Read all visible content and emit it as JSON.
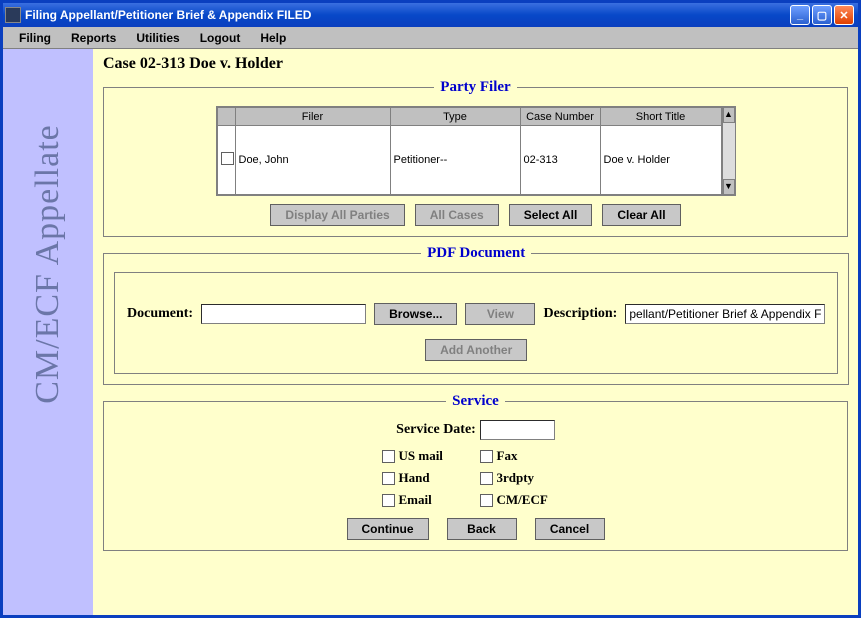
{
  "window": {
    "title": "Filing Appellant/Petitioner Brief & Appendix FILED"
  },
  "menu": {
    "items": [
      "Filing",
      "Reports",
      "Utilities",
      "Logout",
      "Help"
    ]
  },
  "sidebar": {
    "brand": "CM/ECF Appellate"
  },
  "case": {
    "title": "Case 02-313 Doe v. Holder"
  },
  "party_filer": {
    "legend": "Party Filer",
    "columns": [
      "",
      "Filer",
      "Type",
      "Case Number",
      "Short Title"
    ],
    "rows": [
      {
        "checked": false,
        "filer": "Doe, John",
        "type": "Petitioner--",
        "case_number": "02-313",
        "short_title": "Doe v. Holder"
      }
    ],
    "buttons": {
      "display_all_parties": "Display All Parties",
      "all_cases": "All Cases",
      "select_all": "Select All",
      "clear_all": "Clear All"
    }
  },
  "pdf": {
    "legend": "PDF Document",
    "document_label": "Document:",
    "document_value": "",
    "browse": "Browse...",
    "view": "View",
    "description_label": "Description:",
    "description_value": "pellant/Petitioner Brief & Appendix FILED",
    "add_another": "Add Another"
  },
  "service": {
    "legend": "Service",
    "date_label": "Service Date:",
    "date_value": "",
    "methods": {
      "us_mail": "US mail",
      "fax": "Fax",
      "hand": "Hand",
      "thirdpty": "3rdpty",
      "email": "Email",
      "cmecf": "CM/ECF"
    },
    "continue": "Continue",
    "back": "Back",
    "cancel": "Cancel"
  }
}
